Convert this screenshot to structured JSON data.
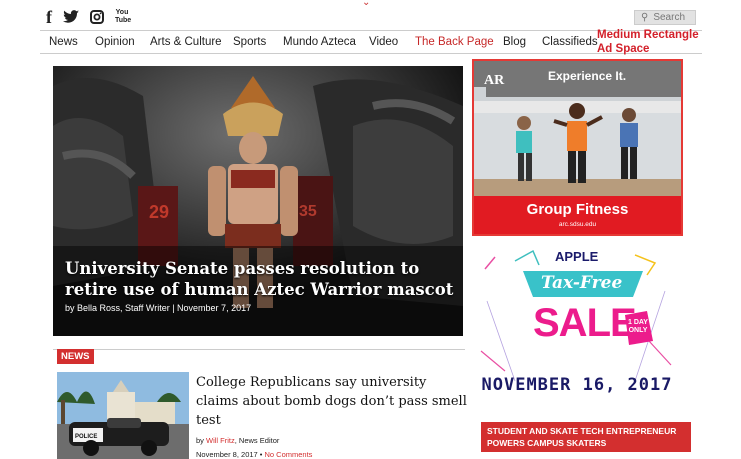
{
  "top": {
    "social_icons": [
      "facebook-icon",
      "twitter-icon",
      "instagram-icon",
      "youtube-icon"
    ],
    "youtube_text": "You\nTube",
    "search_placeholder": "Search"
  },
  "nav": {
    "items": [
      "News",
      "Opinion",
      "Arts & Culture",
      "Sports",
      "Mundo Azteca",
      "Video",
      "The Back Page",
      "Blog",
      "Classifieds"
    ],
    "highlighted": "The Back Page"
  },
  "ad_label": "Medium Rectangle Ad Space",
  "hero": {
    "title": "University Senate passes resolution to retire use of human Aztec Warrior mascot",
    "byline": "by Bella Ross, Staff Writer | November 7, 2017"
  },
  "ad1": {
    "logo": "AR",
    "headline": "Experience It.",
    "title": "Group Fitness",
    "url": "arc.sdsu.edu"
  },
  "ad2": {
    "brand": "APPLE",
    "tagline": "Tax-Free",
    "sale": "SALE",
    "badge": "1 DAY ONLY",
    "date": "NOVEMBER 16, 2017"
  },
  "promo": {
    "text": "STUDENT AND SKATE TECH ENTREPRENEUR POWERS CAMPUS SKATERS"
  },
  "section": {
    "tag": "NEWS"
  },
  "story": {
    "title": "College Republicans say university claims about bomb dogs don’t pass smell test",
    "byline_prefix": "by ",
    "author": "Will Fritz",
    "author_role": ", News Editor",
    "date": "November 8, 2017",
    "separator": " • ",
    "comments": "No Comments"
  },
  "colors": {
    "accent_red": "#d32f2f",
    "ad_border": "#e53935"
  }
}
